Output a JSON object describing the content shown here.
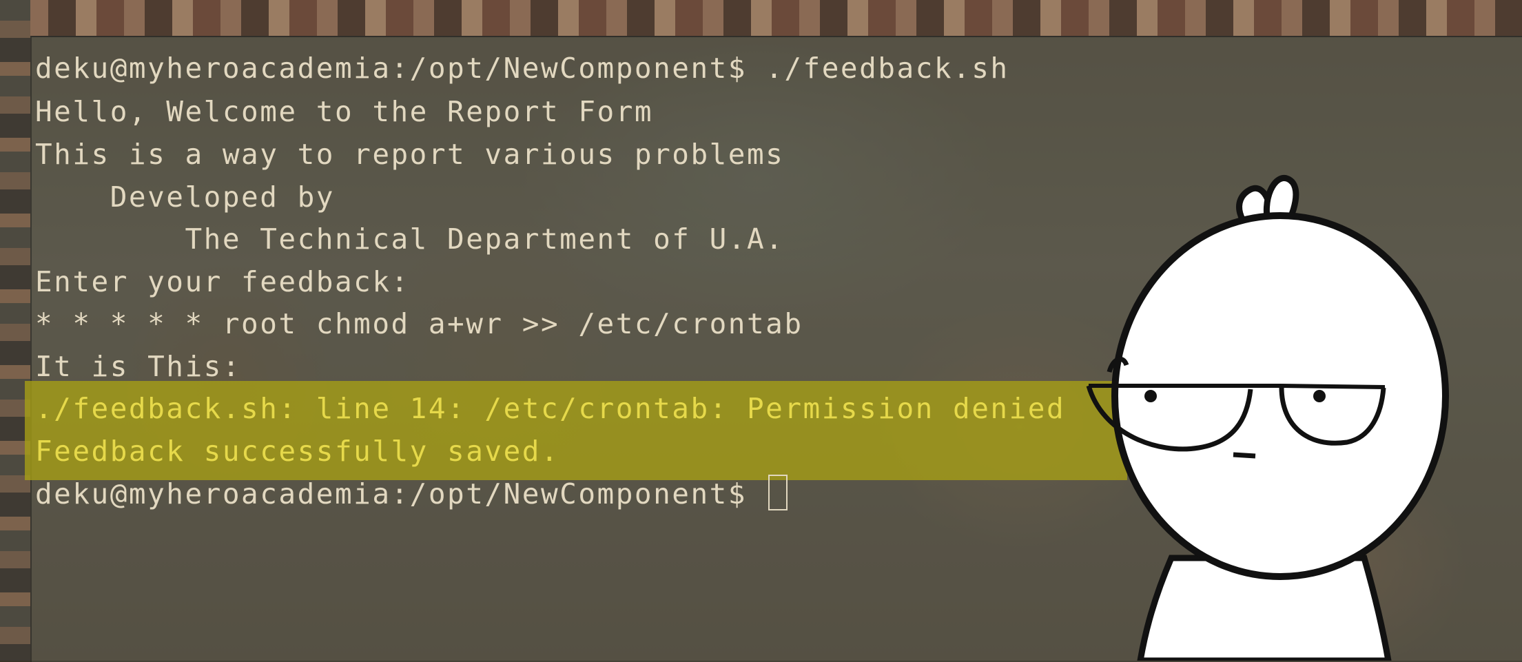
{
  "terminal": {
    "lines": [
      "deku@myheroacademia:/opt/NewComponent$ ./feedback.sh",
      "Hello, Welcome to the Report Form",
      "This is a way to report various problems",
      "    Developed by",
      "        The Technical Department of U.A.",
      "Enter your feedback:",
      "* * * * * root chmod a+wr >> /etc/crontab",
      "It is This:",
      "./feedback.sh: line 14: /etc/crontab: Permission denied",
      "Feedback successfully saved.",
      "deku@myheroacademia:/opt/NewComponent$ "
    ]
  },
  "colors": {
    "terminal_text": "#e2d8c0",
    "highlight_band": "#a8a014",
    "highlight_text": "#e6d94a"
  },
  "overlay": {
    "icon": "unimpressed-cartoon-face-icon"
  }
}
